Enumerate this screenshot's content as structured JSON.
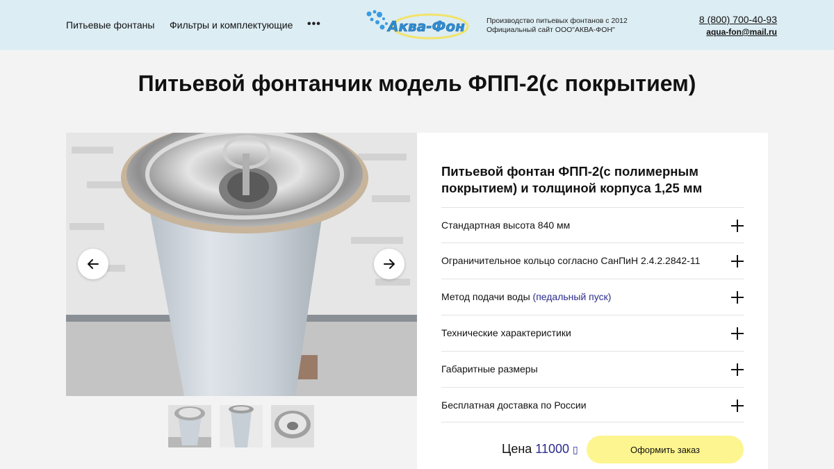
{
  "header": {
    "nav": [
      "Питьевые фонтаны",
      "Фильтры и комплектующие"
    ],
    "more": "•••",
    "logo_text": "Аква-Фон",
    "about_line1": "Производство питьевых фонтанов с 2012",
    "about_line2": "Официальный сайт ООО\"АКВА-ФОН\"",
    "phone": "8 (800) 700-40-93",
    "email": "aqua-fon@mail.ru"
  },
  "page_title": "Питьевой фонтанчик модель ФПП-2(с покрытием)",
  "product": {
    "title": "Питьевой фонтан ФПП-2(с полимерным покрытием) и толщиной  корпуса 1,25 мм",
    "accordion": [
      {
        "label": "Стандартная высота 840 мм"
      },
      {
        "label": "Ограничительное кольцо согласно СанПиН 2.4.2.2842-11"
      },
      {
        "label": "Метод подачи воды ",
        "highlight": "(педальный пуск)"
      },
      {
        "label": "Технические характеристики"
      },
      {
        "label": "Габаритные размеры"
      },
      {
        "label": "Бесплатная доставка по России"
      }
    ],
    "price_label": "Цена",
    "price_value": "11000",
    "currency_glyph": "▯",
    "order_label": "Оформить заказ"
  },
  "colors": {
    "header_bg": "#dcedf3",
    "page_bg": "#f3f3f3",
    "accent_text": "#2b2b8c",
    "order_button": "#fdf58f",
    "logo_blue": "#2f8fd6"
  },
  "icons": {
    "prev": "arrow-left-icon",
    "next": "arrow-right-icon",
    "expand": "plus-icon"
  }
}
